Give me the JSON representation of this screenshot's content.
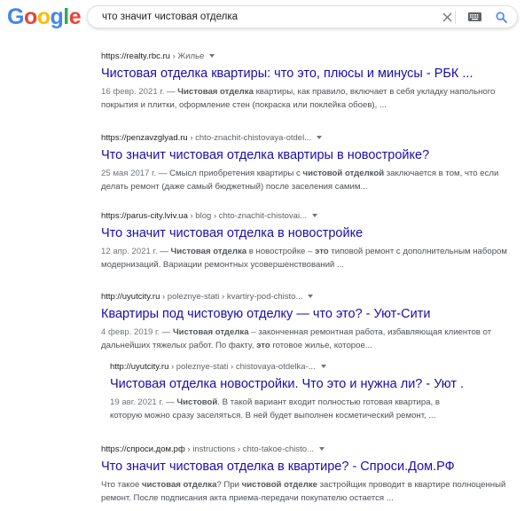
{
  "header": {
    "logo_letters": [
      {
        "ch": "G",
        "color": "#4285f4"
      },
      {
        "ch": "o",
        "color": "#ea4335"
      },
      {
        "ch": "o",
        "color": "#fbbc05"
      },
      {
        "ch": "g",
        "color": "#4285f4"
      },
      {
        "ch": "l",
        "color": "#34a853"
      },
      {
        "ch": "e",
        "color": "#ea4335"
      }
    ],
    "search_query": "что значит чистовая отделка",
    "icons": {
      "clear": "close-icon",
      "keyboard": "keyboard-icon",
      "search": "search-icon"
    },
    "accent_color": "#4285f4"
  },
  "results": [
    {
      "domain": "https://realty.rbc.ru",
      "path": " › Жилье",
      "title": "Чистовая отделка квартиры: что это, плюсы и минусы - РБК ...",
      "date": "16 февр. 2021 г.",
      "snippet_html": " — <b>Чистовая отделка</b> квартиры, как правило, включает в себя укладку напольного покрытия и плитки, оформление стен (покраска или поклейка обоев), ..."
    },
    {
      "domain": "https://penzavzglyad.ru",
      "path": " › chto-znachit-chistovaya-otdel...",
      "title": "Что значит чистовая отделка квартиры в новостройке?",
      "date": "25 мая 2017 г.",
      "snippet_html": " — Смысл приобретения квартиры с <b>чистовой отделкой</b> заключается в том, что если делать ремонт (даже самый бюджетный) после заселения самим..."
    },
    {
      "domain": "https://parus-city.lviv.ua",
      "path": " › blog › chto-znachit-chistovai...",
      "title": "Что значит чистовая отделка в новостройке",
      "date": "12 апр. 2021 г.",
      "snippet_html": " — <b>Чистовая отделка</b> в новостройке – <b>это</b> типовой ремонт с дополнительным набором модернизаций. Вариации ремонтных усовершенствований ..."
    },
    {
      "domain": "http://uyutcity.ru",
      "path": " › poleznye-stati › kvartiry-pod-chisto...",
      "title": "Квартиры под чистовую отделку — что это? - Уют-Сити",
      "date": "4 февр. 2019 г.",
      "snippet_html": " — <b>Чистовая отделка</b> – законченная ремонтная работа, избавляющая клиентов от дальнейших тяжелых работ. По факту, <b>это</b> готовое жилье, которое..."
    },
    {
      "domain": "http://uyutcity.ru",
      "path": " › poleznye-stati › chistovaya-otdelka-...",
      "title": "Чистовая отделка новостройки. Что это и нужна ли? - Уют ...",
      "date": "19 авг. 2021 г.",
      "snippet_html": " — <b>Чистовой</b>. В такой вариант входит полностью готовая квартира, в которую можно сразу заселяться. В ней будет выполнен косметический ремонт, ..."
    },
    {
      "domain": "https://спроси.дом.рф",
      "path": " › instructions › chto-takoe-chisto...",
      "title": "Что значит чистовая отделка в квартире? - Спроси.Дом.РФ",
      "date": "",
      "snippet_html": "Что такое <b>чистовая отделка</b>? При <b>чистовой отделке</b> застройщик проводит в квартире полноценный ремонт. После подписания акта приема-передачи покупателю остается ..."
    }
  ]
}
